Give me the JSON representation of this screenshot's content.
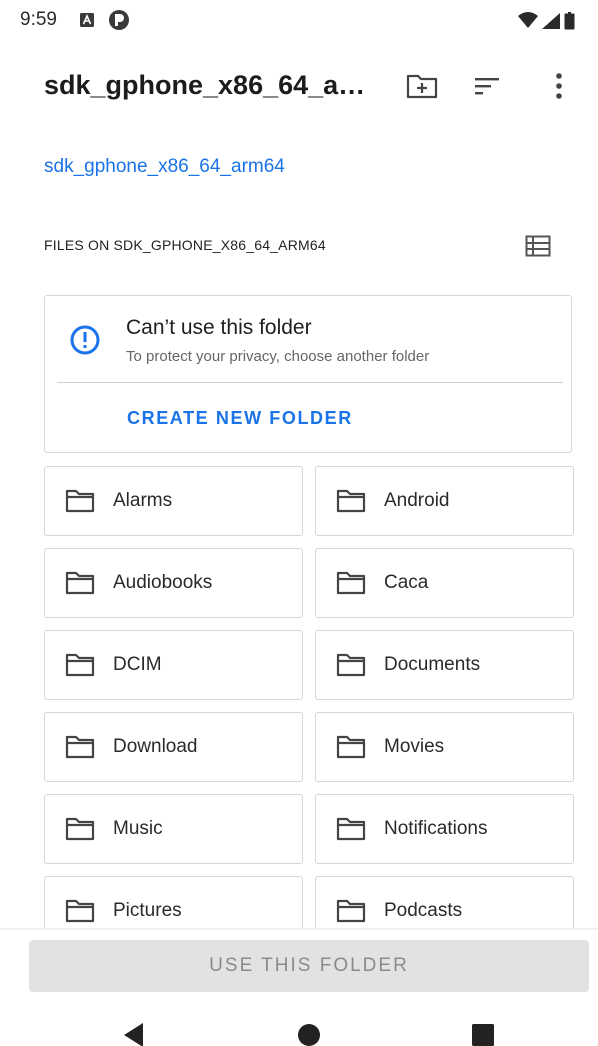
{
  "status_bar": {
    "time": "9:59",
    "icons": [
      "a-notification-icon",
      "p-notification-icon",
      "wifi-icon",
      "signal-icon",
      "battery-icon"
    ]
  },
  "app_bar": {
    "title": "sdk_gphone_x86_64_ar…",
    "actions": [
      "new-folder-icon",
      "sort-icon",
      "more-options-icon"
    ]
  },
  "breadcrumb": "sdk_gphone_x86_64_arm64",
  "section_header": "FILES ON SDK_GPHONE_X86_64_ARM64",
  "info_card": {
    "title": "Can’t use this folder",
    "subtitle": "To protect your privacy, choose another folder",
    "action": "CREATE NEW FOLDER"
  },
  "folders": [
    {
      "label": "Alarms"
    },
    {
      "label": "Android"
    },
    {
      "label": "Audiobooks"
    },
    {
      "label": "Caca"
    },
    {
      "label": "DCIM"
    },
    {
      "label": "Documents"
    },
    {
      "label": "Download"
    },
    {
      "label": "Movies"
    },
    {
      "label": "Music"
    },
    {
      "label": "Notifications"
    },
    {
      "label": "Pictures"
    },
    {
      "label": "Podcasts"
    }
  ],
  "use_folder_button": {
    "label": "USE THIS FOLDER",
    "enabled": false
  },
  "colors": {
    "accent": "#1a73e8",
    "border": "#d6d6d6",
    "disabled_button": "#e2e2e2"
  },
  "nav_bar": [
    "back-icon",
    "home-icon",
    "recents-icon"
  ]
}
